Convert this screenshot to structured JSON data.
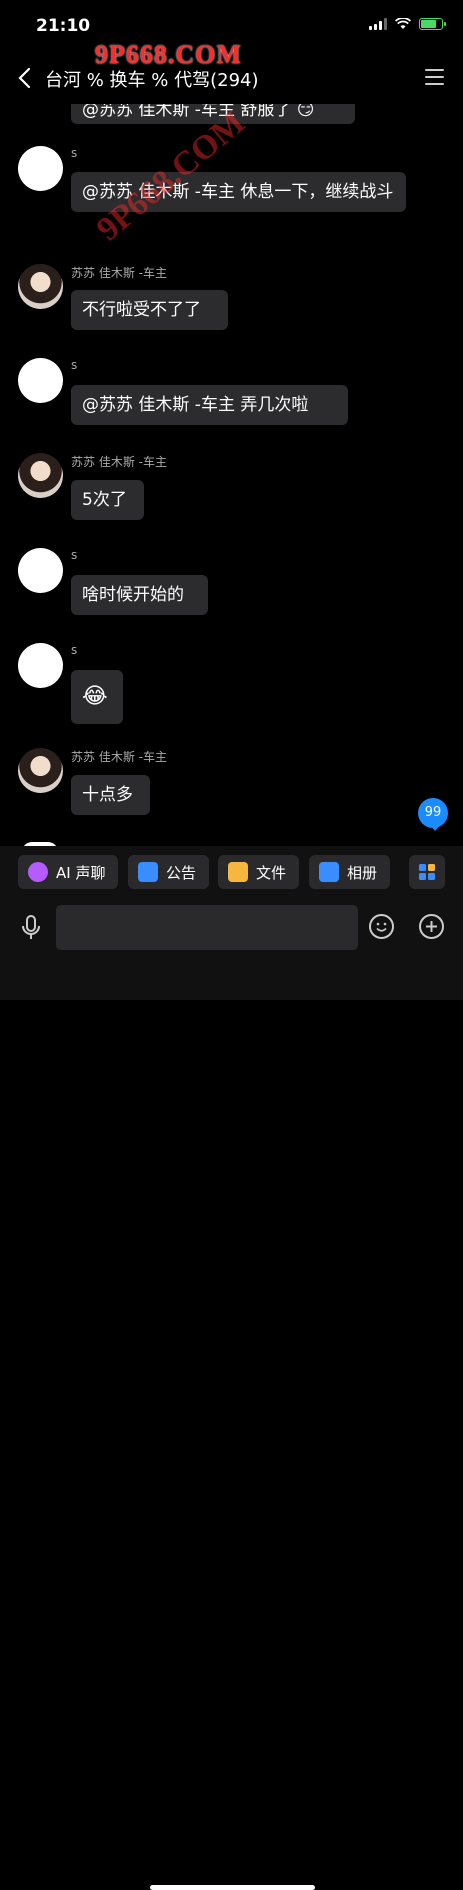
{
  "status_bar": {
    "time": "21:10"
  },
  "watermark": {
    "top": "9P668.COM",
    "diagonal": "9P668.COM"
  },
  "nav": {
    "title": "台河 % 换车 % 代驾(294)"
  },
  "messages": [
    {
      "sender": "s",
      "text": "@苏苏 佳木斯 -车主 休息一下，继续战斗"
    },
    {
      "sender": "苏苏 佳木斯 -车主",
      "text": "不行啦受不了了"
    },
    {
      "sender": "s",
      "text": "@苏苏 佳木斯 -车主 弄几次啦"
    },
    {
      "sender": "苏苏 佳木斯 -车主",
      "text": "5次了"
    },
    {
      "sender": "s",
      "text": "啥时候开始的"
    },
    {
      "sender": "s",
      "text": "😂"
    },
    {
      "sender": "苏苏 佳木斯 -车主",
      "text": "十点多"
    }
  ],
  "partial_message": "@苏苏 佳木斯 -车主 舒服了 😏",
  "unread_count": "99",
  "toolbar": [
    {
      "label": "AI 声聊",
      "icon": "ai-voice-icon",
      "color": "#b45cff"
    },
    {
      "label": "公告",
      "icon": "announcement-icon",
      "color": "#3a8dff"
    },
    {
      "label": "文件",
      "icon": "folder-icon",
      "color": "#f5b740"
    },
    {
      "label": "相册",
      "icon": "photo-album-icon",
      "color": "#3a8dff"
    }
  ],
  "colors": {
    "bubble": "#2c2c2e",
    "accent": "#1a8cff",
    "background": "#000000"
  }
}
